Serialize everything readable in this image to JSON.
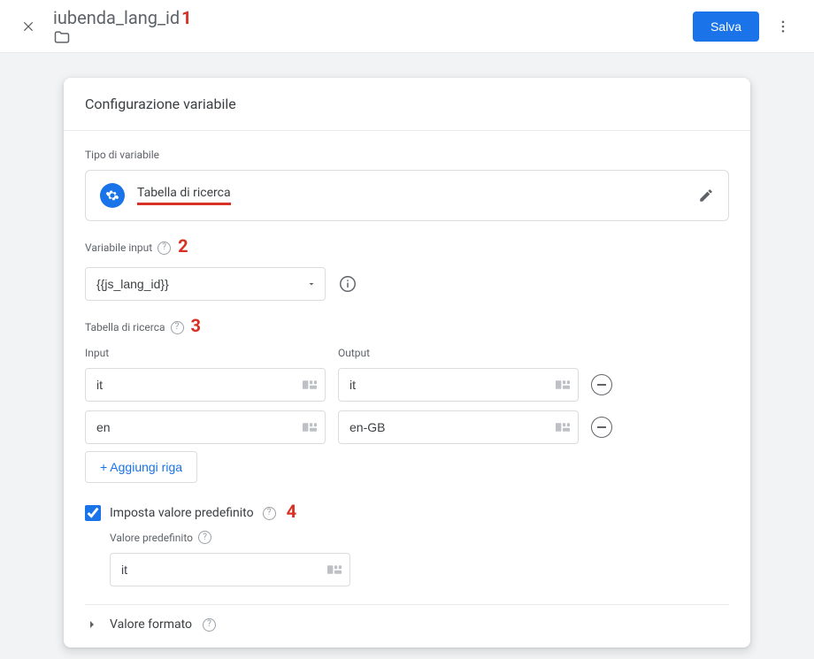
{
  "header": {
    "variable_name": "iubenda_lang_id",
    "save_label": "Salva"
  },
  "annotations": {
    "a1": "1",
    "a2": "2",
    "a3": "3",
    "a4": "4"
  },
  "card": {
    "title": "Configurazione variabile",
    "type_section_label": "Tipo di variabile",
    "type_name": "Tabella di ricerca",
    "input_var_label": "Variabile input",
    "input_var_value": "{{js_lang_id}}",
    "lookup_label": "Tabella di ricerca",
    "col_input": "Input",
    "col_output": "Output",
    "rows": [
      {
        "in": "it",
        "out": "it"
      },
      {
        "in": "en",
        "out": "en-GB"
      }
    ],
    "add_row_label": "+ Aggiungi riga",
    "default_check_label": "Imposta valore predefinito",
    "default_value_label": "Valore predefinito",
    "default_value": "it",
    "format_label": "Valore formato"
  }
}
